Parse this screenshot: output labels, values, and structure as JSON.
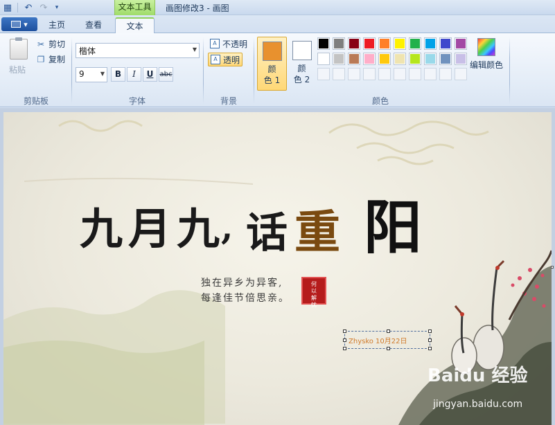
{
  "window": {
    "title": "画图修改3 - 画图",
    "context_tab": "文本工具"
  },
  "quick_access": {
    "app_icon": "paint-app-icon",
    "undo_icon": "undo-icon",
    "redo_icon": "redo-icon",
    "customize_icon": "chevron-down-icon"
  },
  "tabs": [
    {
      "label": "主页",
      "active": false
    },
    {
      "label": "查看",
      "active": false
    },
    {
      "label": "文本",
      "active": true
    }
  ],
  "ribbon": {
    "clipboard": {
      "label": "剪贴板",
      "paste": "粘贴",
      "cut": "剪切",
      "copy": "复制"
    },
    "font": {
      "label": "字体",
      "family": "楷体",
      "size": "9",
      "bold": "B",
      "italic": "I",
      "underline": "U",
      "strikethrough": "abc"
    },
    "background": {
      "label": "背景",
      "opaque": "不透明",
      "transparent": "透明",
      "selected": "transparent"
    },
    "colors": {
      "label": "颜色",
      "color1_label_a": "颜",
      "color1_label_b": "色 1",
      "color1_value": "#e8912e",
      "color2_label_a": "颜",
      "color2_label_b": "色 2",
      "color2_value": "#ffffff",
      "edit_colors": "编辑颜色",
      "palette_row1": [
        "#000000",
        "#7f7f7f",
        "#880015",
        "#ed1c24",
        "#ff7f27",
        "#fff200",
        "#22b14c",
        "#00a2e8",
        "#3f48cc",
        "#a349a4"
      ],
      "palette_row2": [
        "#ffffff",
        "#c3c3c3",
        "#b97a57",
        "#ffaec9",
        "#ffc90e",
        "#efe4b0",
        "#b5e61d",
        "#99d9ea",
        "#7092be",
        "#c8bfe7"
      ]
    }
  },
  "canvas": {
    "headline": "九月九,话重阳",
    "poem_line1": "独在异乡为异客,",
    "poem_line2": "每逢佳节倍思亲。",
    "seal_text": "何以解忧",
    "textbox_content": "Zhysko  10月22日",
    "watermark": "Baidu 经验",
    "watermark_sub": "jingyan.baidu.com"
  }
}
